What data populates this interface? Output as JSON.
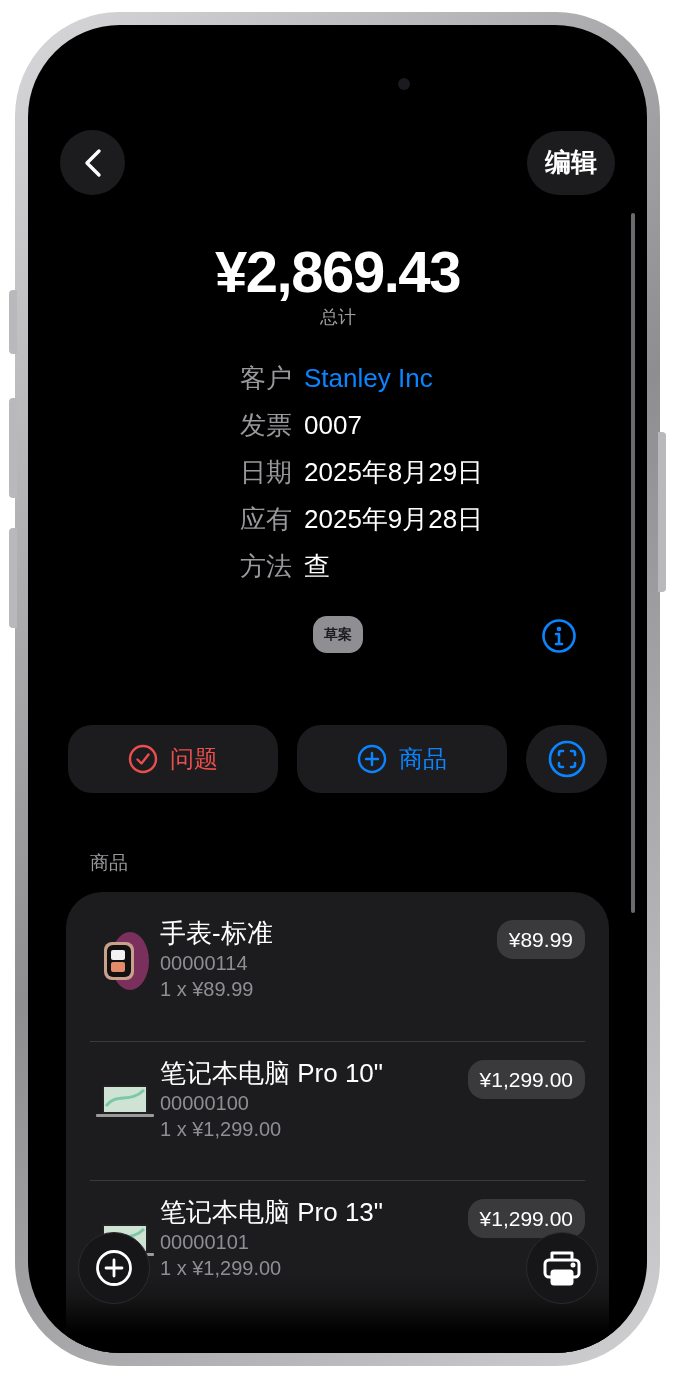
{
  "nav": {
    "edit_button": "编辑"
  },
  "total": {
    "amount": "¥2,869.43",
    "label": "总计"
  },
  "details": [
    {
      "label": "客户",
      "value": "Stanley Inc",
      "kind": "link"
    },
    {
      "label": "发票",
      "value": "0007",
      "kind": "text"
    },
    {
      "label": "日期",
      "value": "2025年8月29日",
      "kind": "text"
    },
    {
      "label": "应有",
      "value": "2025年9月28日",
      "kind": "text"
    },
    {
      "label": "方法",
      "value": "查",
      "kind": "text"
    }
  ],
  "status_badge": "草案",
  "actions": [
    {
      "label": "问题",
      "kind": "issue"
    },
    {
      "label": "商品",
      "kind": "add"
    },
    {
      "kind": "scan"
    }
  ],
  "items_section": {
    "title": "商品",
    "items": [
      {
        "kind": "watch",
        "name": "手表-标准",
        "code": "00000114",
        "quantity": "1 x ¥89.99",
        "price": "¥89.99"
      },
      {
        "kind": "laptop",
        "name": "笔记本电脑 Pro 10\"",
        "code": "00000100",
        "quantity": "1 x ¥1,299.00",
        "price": "¥1,299.00"
      },
      {
        "kind": "laptop",
        "name": "笔记本电脑 Pro 13\"",
        "code": "00000101",
        "quantity": "1 x ¥1,299.00",
        "price": "¥1,299.00"
      }
    ]
  }
}
